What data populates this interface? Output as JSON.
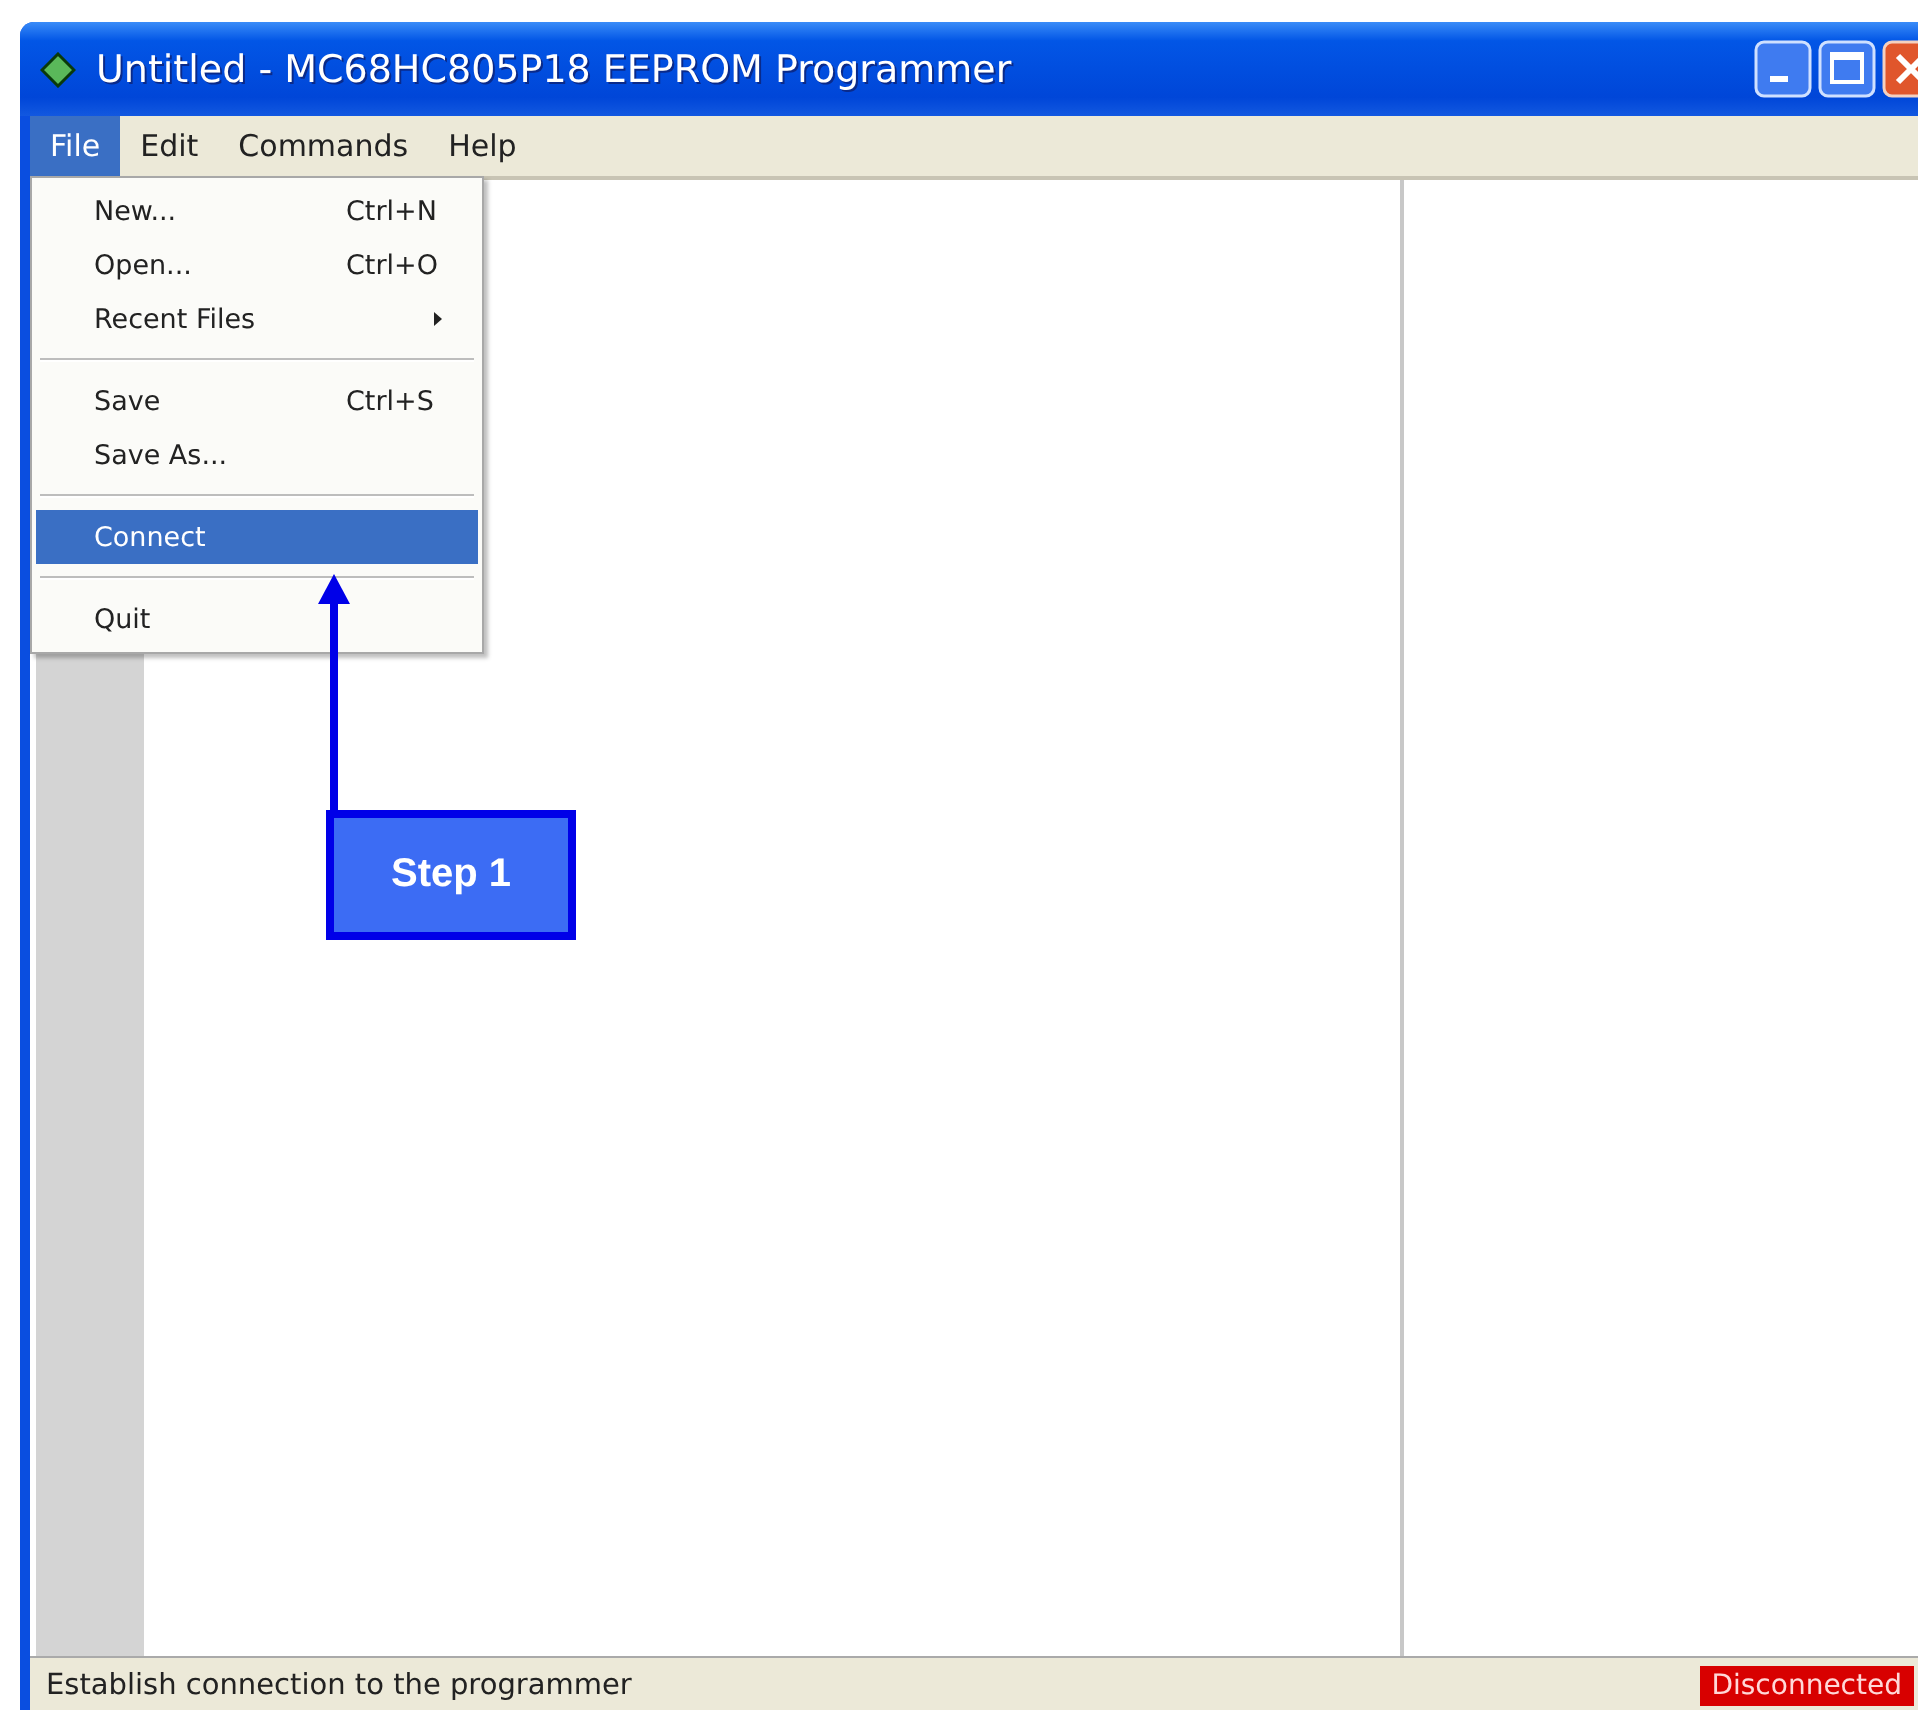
{
  "window": {
    "title": "Untitled - MC68HC805P18 EEPROM Programmer"
  },
  "menu_bar": [
    {
      "label": "File",
      "selected": true
    },
    {
      "label": "Edit",
      "selected": false
    },
    {
      "label": "Commands",
      "selected": false
    },
    {
      "label": "Help",
      "selected": false
    }
  ],
  "file_menu": [
    {
      "kind": "item",
      "label": "New...",
      "shortcut": "Ctrl+N",
      "selected": false
    },
    {
      "kind": "item",
      "label": "Open...",
      "shortcut": "Ctrl+O",
      "selected": false
    },
    {
      "kind": "submenu",
      "label": "Recent Files",
      "selected": false
    },
    {
      "kind": "separator"
    },
    {
      "kind": "item",
      "label": "Save",
      "shortcut": "Ctrl+S",
      "selected": false
    },
    {
      "kind": "item",
      "label": "Save As...",
      "selected": false
    },
    {
      "kind": "separator"
    },
    {
      "kind": "item",
      "label": "Connect",
      "selected": true
    },
    {
      "kind": "separator"
    },
    {
      "kind": "item",
      "label": "Quit",
      "selected": false
    }
  ],
  "callout": {
    "label": "Step 1"
  },
  "status_bar": {
    "message": "Establish connection to the programmer",
    "connection": {
      "label": "Disconnected",
      "connected": false
    }
  }
}
